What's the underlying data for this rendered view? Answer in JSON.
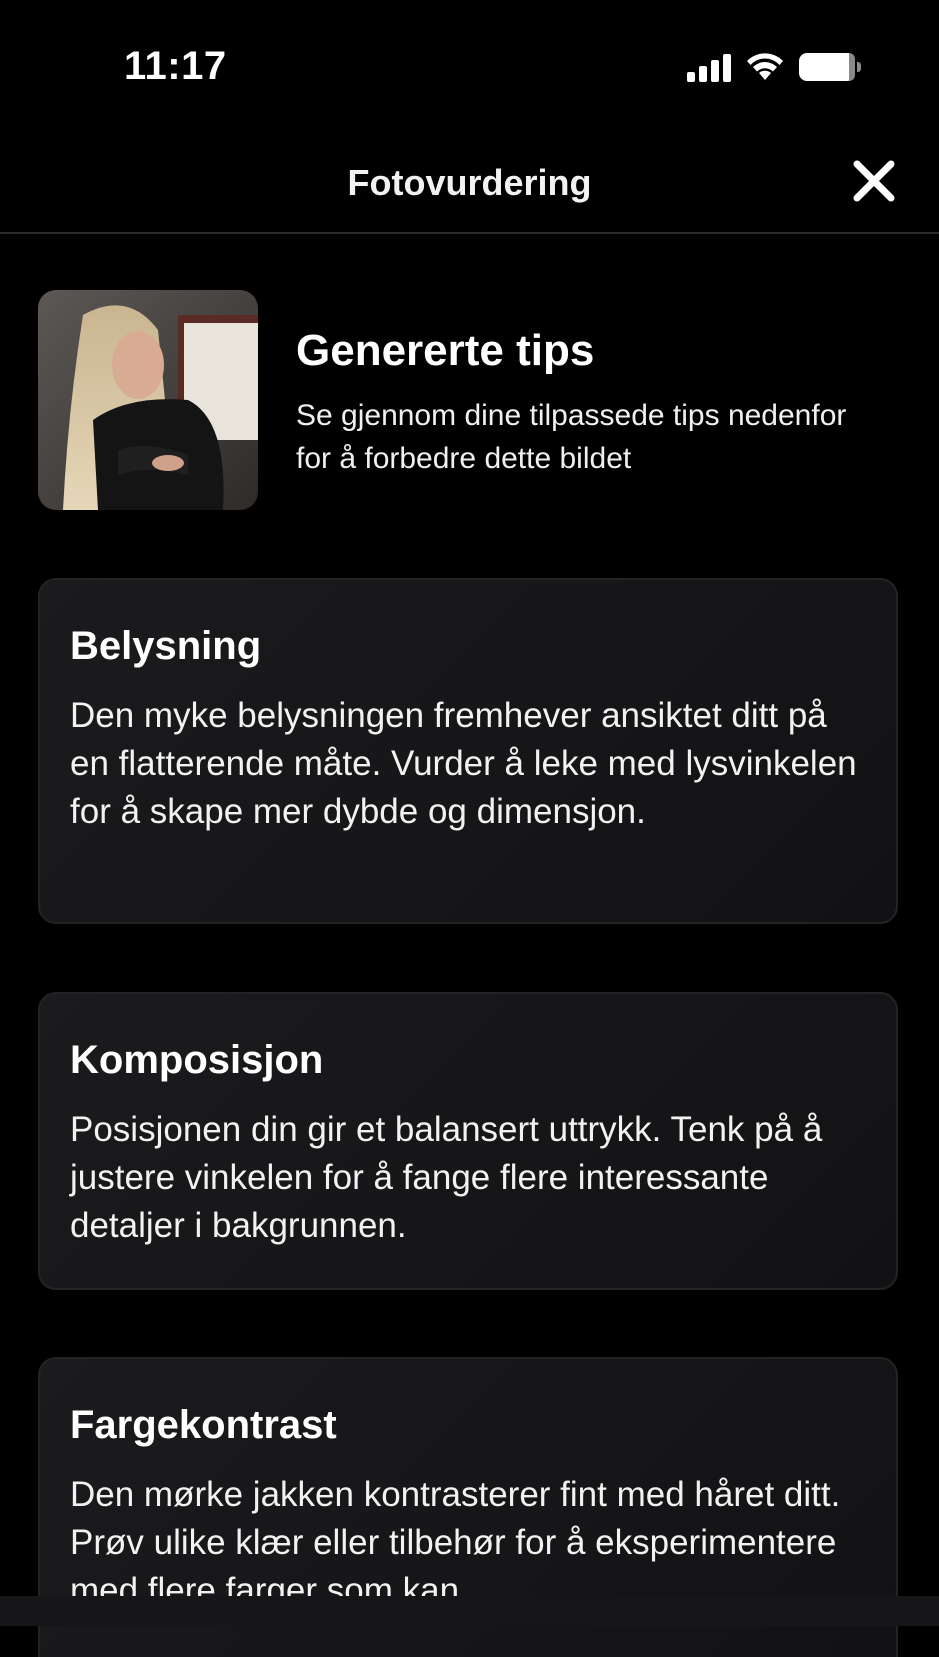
{
  "status_bar": {
    "time": "11:17"
  },
  "nav": {
    "title": "Fotovurdering"
  },
  "header": {
    "title": "Genererte tips",
    "subtitle": "Se gjennom dine tilpassede tips nedenfor for å forbedre dette bildet"
  },
  "tips": [
    {
      "title": "Belysning",
      "body": "Den myke belysningen fremhever ansiktet ditt på en flatterende måte. Vurder å leke med lysvinkelen for å skape mer dybde og dimensjon."
    },
    {
      "title": "Komposisjon",
      "body": "Posisjonen din gir et balansert uttrykk. Tenk på å justere vinkelen for å fange flere interessante detaljer i bakgrunnen."
    },
    {
      "title": "Fargekontrast",
      "body": "Den mørke jakken kontrasterer fint med håret ditt. Prøv ulike klær eller tilbehør for å eksperimentere med flere farger som kan"
    }
  ],
  "colors": {
    "background": "#000000",
    "card": "#1b1b1d",
    "text": "#ffffff"
  },
  "icons": {
    "close": "close-icon",
    "signal": "signal-icon",
    "wifi": "wifi-icon",
    "battery": "battery-icon"
  }
}
